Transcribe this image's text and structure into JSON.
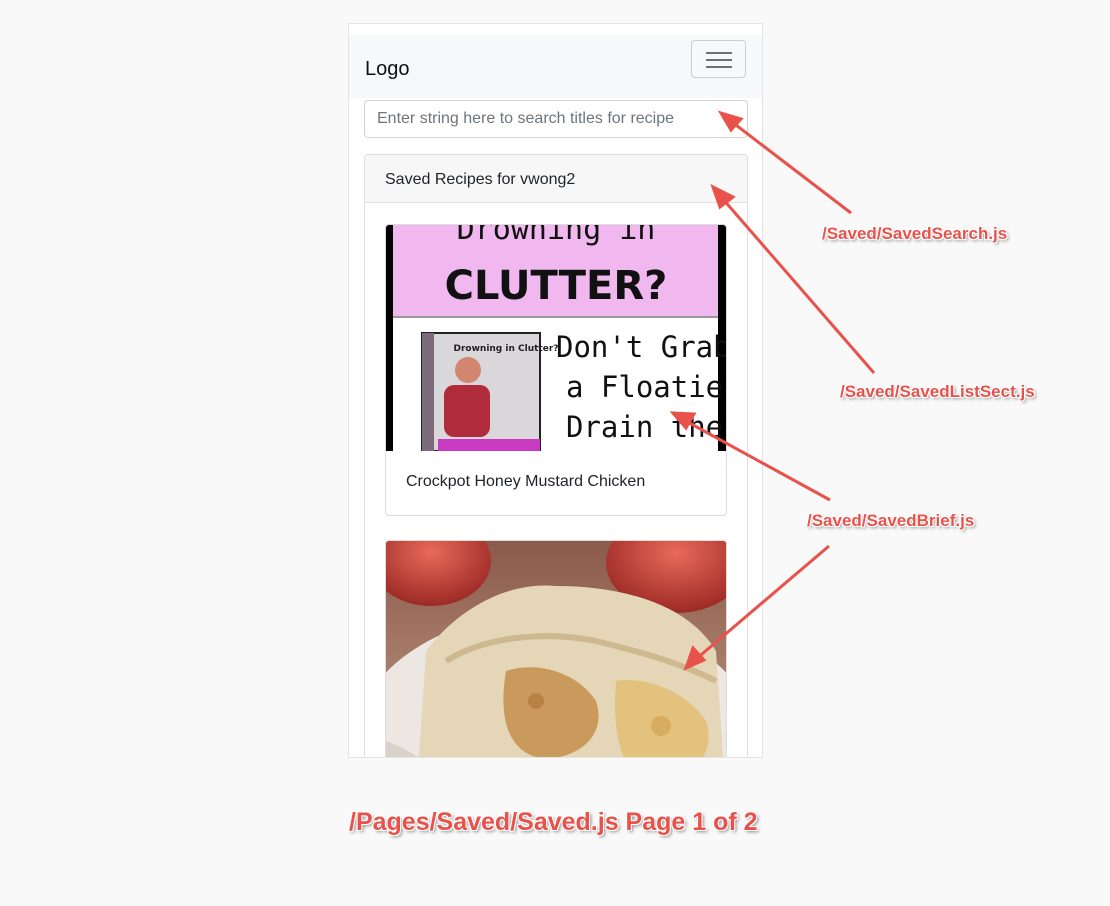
{
  "navbar": {
    "logo": "Logo",
    "menu_icon": "hamburger-menu-icon"
  },
  "search": {
    "placeholder": "Enter string here to search titles for recipe",
    "value": ""
  },
  "saved_section": {
    "header": "Saved Recipes for vwong2",
    "recipes": [
      {
        "title": "Crockpot Honey Mustard Chicken",
        "image_text": {
          "top": "Drowning in",
          "headline": "CLUTTER?",
          "book_title": "Drowning in Clutter?",
          "line1": "Don't Grab",
          "line2": "a Floatie!",
          "line3": "Drain the"
        }
      },
      {
        "title": "",
        "image": "apple-pie-slice-photo"
      }
    ]
  },
  "annotations": {
    "search": "/Saved/SavedSearch.js",
    "list_sect": "/Saved/SavedListSect.js",
    "brief": "/Saved/SavedBrief.js",
    "page": "/Pages/Saved/Saved.js Page 1 of 2"
  },
  "colors": {
    "annotation": "#e8524a",
    "background": "#f9f9f9",
    "image_pink": "#f0b8ee"
  }
}
